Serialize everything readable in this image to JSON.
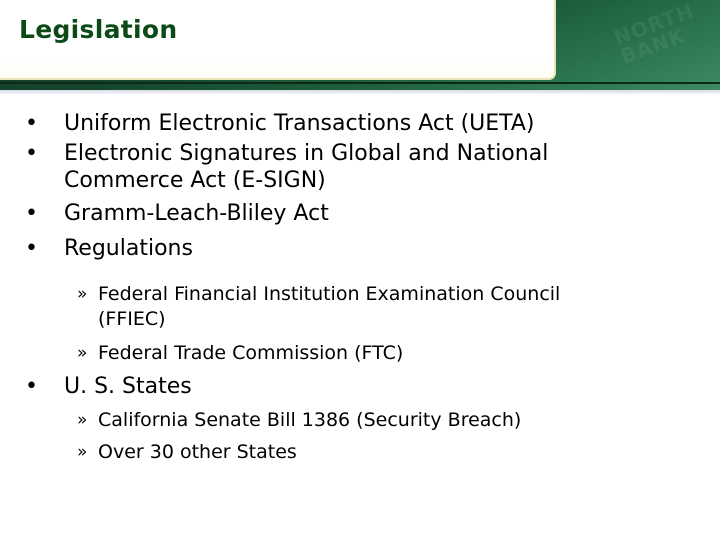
{
  "slide": {
    "title": "Legislation",
    "watermark": "NORTH BANK",
    "colors": {
      "title_text": "#0b4a17",
      "header_dark": "#0f3a24",
      "header_light": "#3f8a62",
      "panel_border": "#e9e3b5"
    },
    "bullets": [
      {
        "marker": "•",
        "lines": [
          "Uniform Electronic Transactions Act (UETA)"
        ]
      },
      {
        "marker": "•",
        "lines": [
          "Electronic Signatures in Global and National",
          "Commerce Act (E-SIGN)"
        ]
      },
      {
        "marker": "•",
        "lines": [
          "Gramm-Leach-Bliley Act"
        ]
      },
      {
        "marker": "•",
        "lines": [
          "Regulations"
        ],
        "sub": [
          {
            "marker": "»",
            "lines": [
              "Federal Financial Institution Examination Council",
              "(FFIEC)"
            ]
          },
          {
            "marker": "»",
            "lines": [
              "Federal Trade Commission (FTC)"
            ]
          }
        ]
      },
      {
        "marker": "•",
        "lines": [
          "U. S. States"
        ],
        "sub": [
          {
            "marker": "»",
            "lines": [
              "California Senate Bill 1386 (Security Breach)"
            ]
          },
          {
            "marker": "»",
            "lines": [
              "Over 30 other States"
            ]
          }
        ]
      }
    ]
  }
}
